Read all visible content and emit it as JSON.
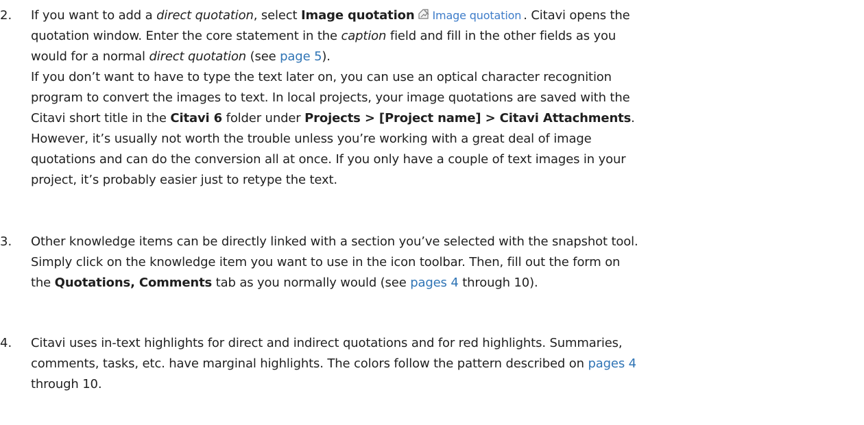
{
  "items": [
    {
      "number": "2.",
      "lines": [
        {
          "segments": [
            {
              "text": "If you want to add a ",
              "style": "plain"
            },
            {
              "text": "direct quotation",
              "style": "italic"
            },
            {
              "text": ", select ",
              "style": "plain"
            },
            {
              "text": "Image quotation",
              "style": "bold"
            },
            {
              "text": "",
              "style": "icon"
            },
            {
              "text": "Image quotation",
              "style": "uilabel"
            },
            {
              "text": ". Citavi opens the",
              "style": "plain"
            }
          ]
        },
        {
          "segments": [
            {
              "text": "quotation window. Enter the core statement in the ",
              "style": "plain"
            },
            {
              "text": "caption",
              "style": "italic"
            },
            {
              "text": " field and fill in the other fields as you",
              "style": "plain"
            }
          ]
        },
        {
          "segments": [
            {
              "text": "would for a normal ",
              "style": "plain"
            },
            {
              "text": "direct quotation",
              "style": "italic"
            },
            {
              "text": " (see ",
              "style": "plain"
            },
            {
              "text": "page 5",
              "style": "link"
            },
            {
              "text": ").",
              "style": "plain"
            }
          ]
        },
        {
          "segments": [
            {
              "text": "If you don’t want to have to type the text later on, you can use an optical character recognition",
              "style": "plain"
            }
          ]
        },
        {
          "segments": [
            {
              "text": "program to convert the images to text. In local projects, your image quotations are saved with the",
              "style": "plain"
            }
          ]
        },
        {
          "segments": [
            {
              "text": "Citavi short title in the ",
              "style": "plain"
            },
            {
              "text": "Citavi 6",
              "style": "bold"
            },
            {
              "text": " folder under ",
              "style": "plain"
            },
            {
              "text": "Projects > [Project name] > Citavi Attachments",
              "style": "bold"
            },
            {
              "text": ".",
              "style": "plain"
            }
          ]
        },
        {
          "segments": [
            {
              "text": "However, it’s usually not worth the trouble unless you’re working with a great deal of image",
              "style": "plain"
            }
          ]
        },
        {
          "segments": [
            {
              "text": "quotations and can do the conversion all at once. If you only have a couple of text images in your",
              "style": "plain"
            }
          ]
        },
        {
          "segments": [
            {
              "text": "project, it’s probably easier just to retype the text.",
              "style": "plain"
            }
          ]
        }
      ]
    },
    {
      "number": "3.",
      "lines": [
        {
          "segments": [
            {
              "text": "Other knowledge items can be directly linked with a section you’ve selected with the snapshot tool.",
              "style": "plain"
            }
          ]
        },
        {
          "segments": [
            {
              "text": "Simply click on the knowledge item you want to use in the icon toolbar. Then, fill out the form on",
              "style": "plain"
            }
          ]
        },
        {
          "segments": [
            {
              "text": "the ",
              "style": "plain"
            },
            {
              "text": "Quotations, Comments",
              "style": "bold"
            },
            {
              "text": " tab as you normally would (see ",
              "style": "plain"
            },
            {
              "text": "pages 4",
              "style": "link"
            },
            {
              "text": " through 10).",
              "style": "plain"
            }
          ]
        }
      ]
    },
    {
      "number": "4.",
      "lines": [
        {
          "segments": [
            {
              "text": "Citavi uses in-text highlights for direct and indirect quotations and for red highlights. Summaries,",
              "style": "plain"
            }
          ]
        },
        {
          "segments": [
            {
              "text": "comments, tasks, etc. have marginal highlights. The colors follow the pattern described on ",
              "style": "plain"
            },
            {
              "text": "pages 4",
              "style": "link"
            }
          ]
        },
        {
          "segments": [
            {
              "text": "through 10.",
              "style": "plain"
            }
          ]
        }
      ]
    }
  ],
  "icon": {
    "name": "image-quotation-icon",
    "color": "#7a7a7a"
  },
  "colors": {
    "text": "#1f1f1f",
    "link": "#2f74b5",
    "ui_label": "#3d7cc9"
  }
}
